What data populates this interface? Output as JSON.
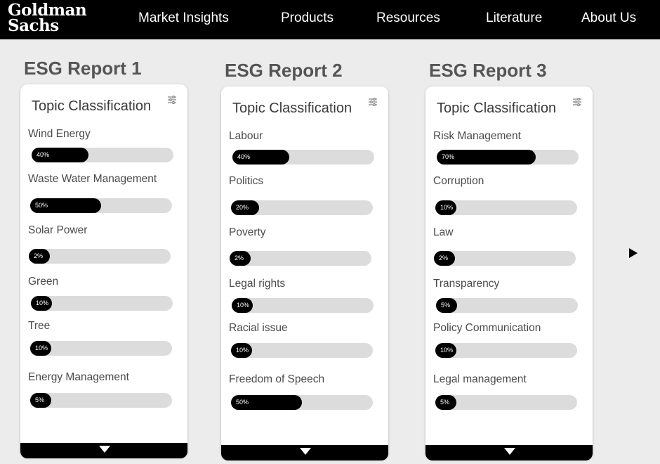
{
  "brand": {
    "line1": "Goldman",
    "line2": "Sachs"
  },
  "nav": [
    "Market Insights",
    "Products",
    "Resources",
    "Literature",
    "About Us"
  ],
  "colors": {
    "bar_fill": "#000000",
    "bar_track": "#dcdcdc",
    "title_gray": "#555555"
  },
  "reports": [
    {
      "title": "ESG Report 1",
      "card_title": "Topic Classification",
      "topics": [
        {
          "label": "Wind Energy",
          "value": 40,
          "pct_text": "40%"
        },
        {
          "label": "Waste Water Management",
          "value": 50,
          "pct_text": "50%"
        },
        {
          "label": "Solar Power",
          "value": 2,
          "pct_text": "2%"
        },
        {
          "label": "Green",
          "value": 10,
          "pct_text": "10%"
        },
        {
          "label": "Tree",
          "value": 10,
          "pct_text": "10%"
        },
        {
          "label": "Energy Management",
          "value": 5,
          "pct_text": "5%"
        }
      ]
    },
    {
      "title": "ESG Report 2",
      "card_title": "Topic Classification",
      "topics": [
        {
          "label": "Labour",
          "value": 40,
          "pct_text": "40%"
        },
        {
          "label": "Politics",
          "value": 20,
          "pct_text": "20%"
        },
        {
          "label": "Poverty",
          "value": 2,
          "pct_text": "2%"
        },
        {
          "label": "Legal rights",
          "value": 10,
          "pct_text": "10%"
        },
        {
          "label": "Racial issue",
          "value": 10,
          "pct_text": "10%"
        },
        {
          "label": "Freedom of Speech",
          "value": 50,
          "pct_text": "50%"
        }
      ]
    },
    {
      "title": "ESG Report 3",
      "card_title": "Topic Classification",
      "topics": [
        {
          "label": "Risk Management",
          "value": 70,
          "pct_text": "70%"
        },
        {
          "label": "Corruption",
          "value": 10,
          "pct_text": "10%"
        },
        {
          "label": "Law",
          "value": 2,
          "pct_text": "2%"
        },
        {
          "label": "Transparency",
          "value": 5,
          "pct_text": "5%"
        },
        {
          "label": "Policy Communication",
          "value": 10,
          "pct_text": "10%"
        },
        {
          "label": "Legal management",
          "value": 5,
          "pct_text": "5%"
        }
      ]
    }
  ],
  "icons": {
    "settings": "sliders-icon",
    "expand": "caret-down-icon",
    "next": "play-arrow-icon"
  }
}
